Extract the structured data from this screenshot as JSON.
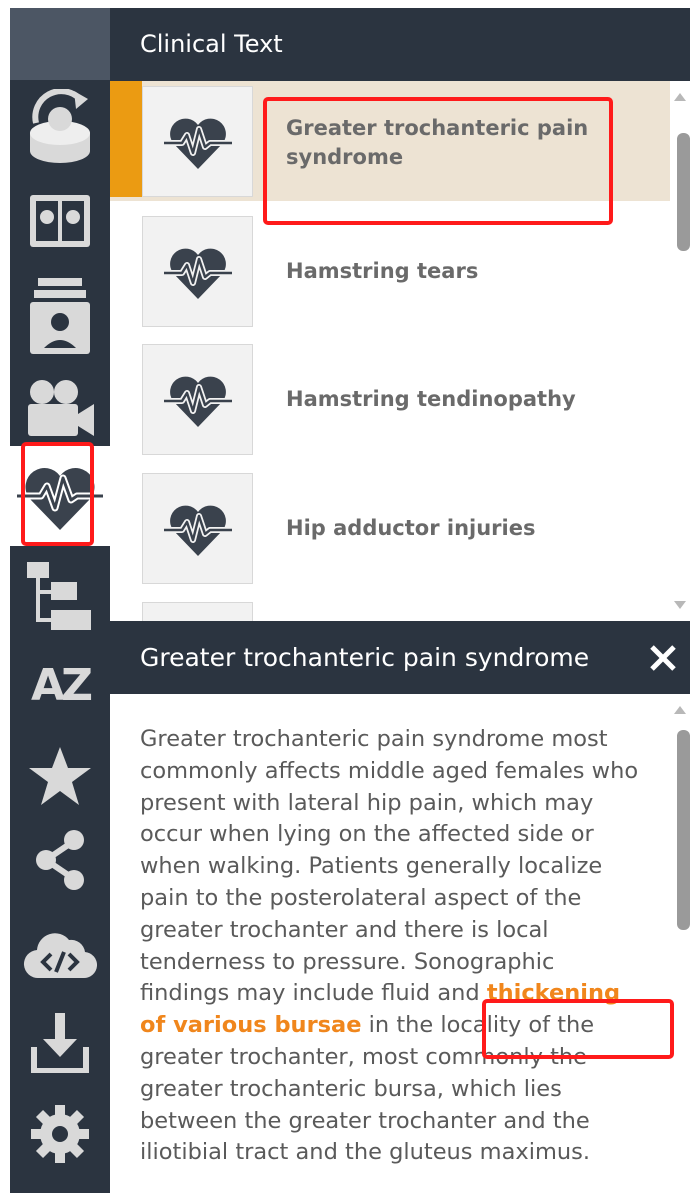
{
  "header": {
    "title": "Clinical Text"
  },
  "sidebar": {
    "items": [
      {
        "icon": "rotate-view-icon"
      },
      {
        "icon": "compare-view-icon"
      },
      {
        "icon": "patient-cards-icon"
      },
      {
        "icon": "video-icon"
      },
      {
        "icon": "heart-pulse-icon",
        "active": true
      },
      {
        "icon": "hierarchy-icon"
      },
      {
        "icon": "a-z-index-icon",
        "label": "AZ"
      },
      {
        "icon": "star-icon"
      },
      {
        "icon": "share-icon"
      },
      {
        "icon": "cloud-embed-icon"
      },
      {
        "icon": "download-icon"
      },
      {
        "icon": "settings-icon"
      }
    ]
  },
  "list": {
    "items": [
      {
        "label": "Greater trochanteric pain syndrome",
        "selected": true
      },
      {
        "label": "Hamstring tears"
      },
      {
        "label": "Hamstring tendinopathy"
      },
      {
        "label": "Hip adductor injuries"
      }
    ]
  },
  "detail": {
    "title": "Greater trochanteric pain syndrome",
    "text_before": "Greater trochanteric pain syndrome most commonly affects middle aged females who present with lateral hip pain, which may occur when lying on the affected side or when walking. Patients generally localize pain to the posterolateral aspect of the greater trochanter and there is local tenderness to pressure. Sonographic findings may include fluid and ",
    "highlight": "thickening of various bursae",
    "text_after": " in the locality of the greater trochanter, most commonly the greater trochanteric bursa, which lies between the greater trochanter and the iliotibial tract and the gluteus maximus."
  },
  "colors": {
    "sidebar": "#2b3440",
    "accent": "#eb9b12",
    "selected_row": "#ede3d3",
    "highlight": "#f0861c",
    "annotation": "#ff1a1a"
  }
}
